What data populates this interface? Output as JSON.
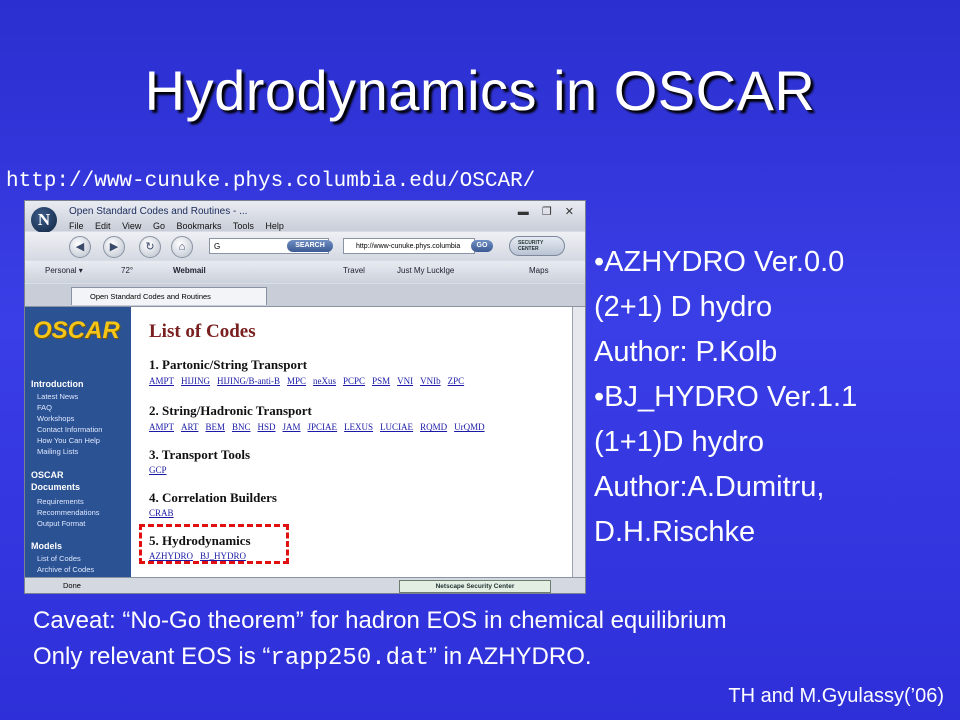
{
  "slide": {
    "title": "Hydrodynamics in OSCAR",
    "url": "http://www-cunuke.phys.columbia.edu/OSCAR/",
    "bullets": [
      "•AZHYDRO Ver.0.0",
      "(2+1) D hydro",
      "Author: P.Kolb",
      "•BJ_HYDRO Ver.1.1",
      "(1+1)D hydro",
      "Author:A.Dumitru,",
      "D.H.Rischke"
    ],
    "caveat": {
      "line1": "Caveat: “No-Go theorem” for hadron EOS in chemical equilibrium",
      "line2_pre": "Only relevant EOS is “",
      "line2_code": "rapp250.dat",
      "line2_post": "” in AZHYDRO."
    },
    "credit": "TH and M.Gyulassy(’06)",
    "highlight_color": "#e01010"
  },
  "browser": {
    "window_title": "Open Standard Codes and Routines - ...",
    "window_controls": "▬ ❐ ✕",
    "menu": [
      "File",
      "Edit",
      "View",
      "Go",
      "Bookmarks",
      "Tools",
      "Help"
    ],
    "search_placeholder": "G",
    "search_button": "SEARCH",
    "address": "http://www-cunuke.phys.columbia",
    "go_button": "GO",
    "security_button": "SECURITY CENTER",
    "personal_bar": {
      "personal": "Personal ▾",
      "weather": "72°",
      "webmail": "Webmail",
      "travel": "Travel",
      "lucklge": "Just My Lucklge",
      "maps": "Maps"
    },
    "tab_label": "Open Standard Codes and Routines",
    "status": "Done",
    "security_status": "Netscape Security Center",
    "sidebar": {
      "logo": "OSCAR",
      "sections": [
        {
          "heading": "Introduction",
          "items": [
            "Latest News",
            "FAQ",
            "Workshops",
            "Contact Information",
            "How You Can Help",
            "Mailing Lists"
          ]
        },
        {
          "heading": "OSCAR Documents",
          "items": [
            "Requirements",
            "Recommendations",
            "Output Format"
          ]
        },
        {
          "heading": "Models",
          "items": [
            "List of Codes",
            "Archive of Codes"
          ]
        }
      ]
    },
    "page": {
      "title": "List of Codes",
      "sections": [
        {
          "heading": "1. Partonic/String Transport",
          "links": [
            "AMPT",
            "HIJING",
            "HIJING/B-anti-B",
            "MPC",
            "neXus",
            "PCPC",
            "PSM",
            "VNI",
            "VNIb",
            "ZPC"
          ]
        },
        {
          "heading": "2. String/Hadronic Transport",
          "links": [
            "AMPT",
            "ART",
            "BEM",
            "BNC",
            "HSD",
            "JAM",
            "JPCIAE",
            "LEXUS",
            "LUCIAE",
            "RQMD",
            "UrQMD"
          ]
        },
        {
          "heading": "3. Transport Tools",
          "links": [
            "GCP"
          ]
        },
        {
          "heading": "4. Correlation Builders",
          "links": [
            "CRAB"
          ]
        },
        {
          "heading": "5. Hydrodynamics",
          "links": [
            "AZHYDRO",
            "BJ_HYDRO"
          ]
        }
      ]
    }
  }
}
